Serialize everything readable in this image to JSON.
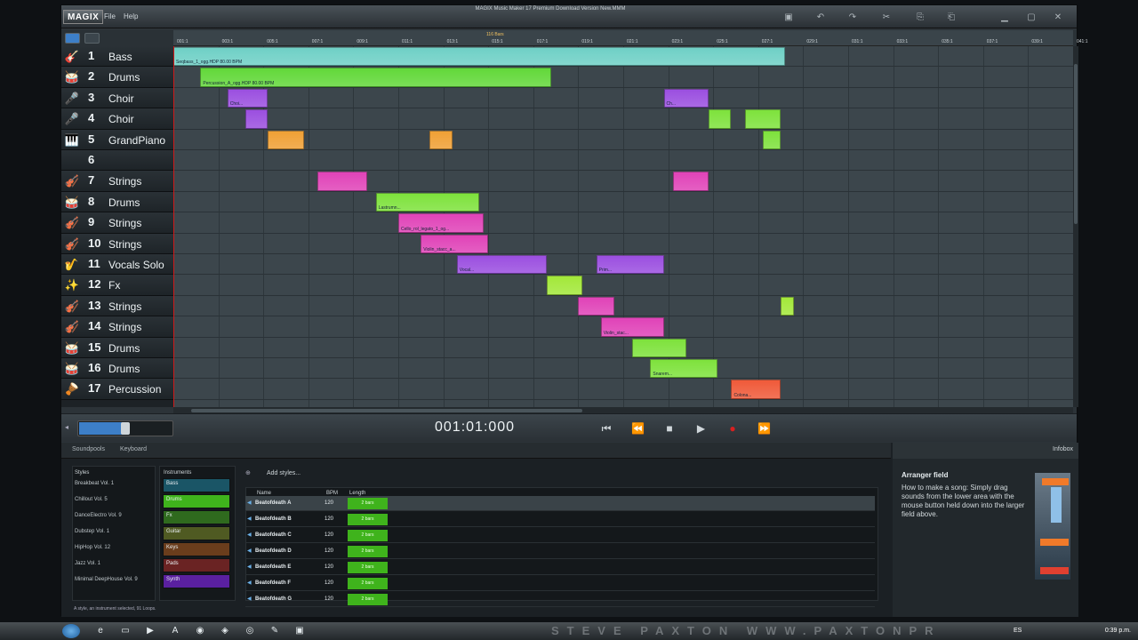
{
  "window": {
    "logo": "MAGIX",
    "menu": [
      "File",
      "Help"
    ],
    "title": "MAGIX Music Maker 17 Premium Download Version    New.MMM"
  },
  "ruler": {
    "label": "116 Bars",
    "ticks": [
      "001:1",
      "003:1",
      "005:1",
      "007:1",
      "009:1",
      "011:1",
      "013:1",
      "015:1",
      "017:1",
      "019:1",
      "021:1",
      "023:1",
      "025:1",
      "027:1",
      "029:1",
      "031:1",
      "033:1",
      "035:1",
      "037:1",
      "039:1",
      "041:1"
    ]
  },
  "tracks": [
    {
      "num": "1",
      "name": "Bass",
      "icon": "bass-guitar-icon",
      "glyph": "🎸"
    },
    {
      "num": "2",
      "name": "Drums",
      "icon": "drum-icon",
      "glyph": "🥁"
    },
    {
      "num": "3",
      "name": "Choir",
      "icon": "microphone-icon",
      "glyph": "🎤"
    },
    {
      "num": "4",
      "name": "Choir",
      "icon": "microphone-icon",
      "glyph": "🎤"
    },
    {
      "num": "5",
      "name": "GrandPiano",
      "icon": "piano-icon",
      "glyph": "🎹"
    },
    {
      "num": "6",
      "name": "",
      "icon": "empty-icon",
      "glyph": ""
    },
    {
      "num": "7",
      "name": "Strings",
      "icon": "violin-icon",
      "glyph": "🎻"
    },
    {
      "num": "8",
      "name": "Drums",
      "icon": "drum-icon",
      "glyph": "🥁"
    },
    {
      "num": "9",
      "name": "Strings",
      "icon": "violin-icon",
      "glyph": "🎻"
    },
    {
      "num": "10",
      "name": "Strings",
      "icon": "violin-icon",
      "glyph": "🎻"
    },
    {
      "num": "11",
      "name": "Vocals Solo",
      "icon": "saxophone-icon",
      "glyph": "🎷"
    },
    {
      "num": "12",
      "name": "Fx",
      "icon": "sound-fx-icon",
      "glyph": "✨"
    },
    {
      "num": "13",
      "name": "Strings",
      "icon": "violin-icon",
      "glyph": "🎻"
    },
    {
      "num": "14",
      "name": "Strings",
      "icon": "violin-icon",
      "glyph": "🎻"
    },
    {
      "num": "15",
      "name": "Drums",
      "icon": "drum-icon",
      "glyph": "🥁"
    },
    {
      "num": "16",
      "name": "Drums",
      "icon": "drum-icon",
      "glyph": "🥁"
    },
    {
      "num": "17",
      "name": "Percussion",
      "icon": "conga-icon",
      "glyph": "🪘"
    }
  ],
  "objects": [
    {
      "track": 1,
      "start": 0,
      "end": 13.6,
      "color": "#6fd0c6",
      "label": "Seqbass_1_ogg.HDP  80.00 BPM"
    },
    {
      "track": 2,
      "start": 0.6,
      "end": 8.4,
      "color": "#62d83a",
      "label": "Percussion_A_ogg.HDP  80.00 BPM"
    },
    {
      "track": 3,
      "start": 1.2,
      "end": 2.1,
      "color": "#9b4fe0",
      "label": "Choi..."
    },
    {
      "track": 3,
      "start": 10.9,
      "end": 11.9,
      "color": "#9b4fe0",
      "label": "Ch..."
    },
    {
      "track": 4,
      "start": 1.6,
      "end": 2.1,
      "color": "#9b4fe0",
      "label": ""
    },
    {
      "track": 4,
      "start": 11.9,
      "end": 12.4,
      "color": "#7ee23c",
      "label": ""
    },
    {
      "track": 4,
      "start": 12.7,
      "end": 13.5,
      "color": "#7ee23c",
      "label": ""
    },
    {
      "track": 5,
      "start": 2.1,
      "end": 2.9,
      "color": "#f0a035",
      "label": ""
    },
    {
      "track": 5,
      "start": 5.7,
      "end": 6.2,
      "color": "#f0a035",
      "label": ""
    },
    {
      "track": 5,
      "start": 13.1,
      "end": 13.5,
      "color": "#7ee23c",
      "label": ""
    },
    {
      "track": 7,
      "start": 3.2,
      "end": 4.3,
      "color": "#e043b8",
      "label": ""
    },
    {
      "track": 7,
      "start": 11.1,
      "end": 11.9,
      "color": "#e043b8",
      "label": ""
    },
    {
      "track": 8,
      "start": 4.5,
      "end": 6.8,
      "color": "#7ee23c",
      "label": "Lastrumn..."
    },
    {
      "track": 9,
      "start": 5.0,
      "end": 6.9,
      "color": "#e043b8",
      "label": "Cello_rol_legato_1_og..."
    },
    {
      "track": 10,
      "start": 5.5,
      "end": 7.0,
      "color": "#e043b8",
      "label": "Violin_stacc_a..."
    },
    {
      "track": 11,
      "start": 6.3,
      "end": 8.3,
      "color": "#9b4fe0",
      "label": "Vocal..."
    },
    {
      "track": 11,
      "start": 9.4,
      "end": 10.9,
      "color": "#9b4fe0",
      "label": "Prim..."
    },
    {
      "track": 12,
      "start": 8.3,
      "end": 9.1,
      "color": "#a3e83a",
      "label": ""
    },
    {
      "track": 13,
      "start": 9.0,
      "end": 9.8,
      "color": "#e043b8",
      "label": ""
    },
    {
      "track": 13,
      "start": 13.5,
      "end": 13.8,
      "color": "#a3e83a",
      "label": ""
    },
    {
      "track": 14,
      "start": 9.5,
      "end": 10.9,
      "color": "#e043b8",
      "label": "Violin_stac..."
    },
    {
      "track": 15,
      "start": 10.2,
      "end": 11.4,
      "color": "#7ee23c",
      "label": ""
    },
    {
      "track": 16,
      "start": 10.6,
      "end": 12.1,
      "color": "#7ee23c",
      "label": "Snarem..."
    },
    {
      "track": 17,
      "start": 12.4,
      "end": 13.5,
      "color": "#f05a3a",
      "label": "Colona..."
    }
  ],
  "transport": {
    "timecode": "001:01:000",
    "buttons": [
      {
        "name": "go-to-start-button",
        "glyph": "⏮"
      },
      {
        "name": "rewind-button",
        "glyph": "⏪"
      },
      {
        "name": "stop-button",
        "glyph": "■"
      },
      {
        "name": "play-button",
        "glyph": "▶"
      },
      {
        "name": "record-button",
        "glyph": "●"
      },
      {
        "name": "fast-forward-button",
        "glyph": "⏩"
      }
    ]
  },
  "panel": {
    "tabs": [
      "Soundpools",
      "Keyboard"
    ],
    "styles_header": "Styles",
    "instruments_header": "Instruments",
    "add_styles": "Add styles...",
    "styles": [
      "Breakbeat Vol. 1",
      "Chillout Vol. 5",
      "DanceElectro Vol. 9",
      "Dubstep Vol. 1",
      "HipHop Vol. 12",
      "Jazz Vol. 1",
      "Minimal DeepHouse Vol. 9"
    ],
    "instruments": [
      {
        "label": "Bass",
        "color": "#1a5566"
      },
      {
        "label": "Drums",
        "color": "#3fb31c"
      },
      {
        "label": "Fx",
        "color": "#2f6a1e"
      },
      {
        "label": "Guitar",
        "color": "#4f5a22"
      },
      {
        "label": "Keys",
        "color": "#6a3d1c"
      },
      {
        "label": "Pads",
        "color": "#6a2323"
      },
      {
        "label": "Synth",
        "color": "#5a20a0"
      }
    ],
    "list_headers": {
      "name": "Name",
      "bpm": "BPM",
      "length": "Length"
    },
    "loops": [
      {
        "name": "Beatofdeath A",
        "bpm": "120",
        "length": "2 bars"
      },
      {
        "name": "Beatofdeath B",
        "bpm": "120",
        "length": "2 bars"
      },
      {
        "name": "Beatofdeath C",
        "bpm": "120",
        "length": "2 bars"
      },
      {
        "name": "Beatofdeath D",
        "bpm": "120",
        "length": "2 bars"
      },
      {
        "name": "Beatofdeath E",
        "bpm": "120",
        "length": "2 bars"
      },
      {
        "name": "Beatofdeath F",
        "bpm": "120",
        "length": "2 bars"
      },
      {
        "name": "Beatofdeath G",
        "bpm": "120",
        "length": "2 bars"
      }
    ],
    "status": "A style, an instrument selected, 91 Loops."
  },
  "infobox": {
    "tab": "Infobox",
    "title": "Arranger field",
    "text": "How to make a song: Simply drag sounds from the lower area with the mouse button held down into the larger field above."
  },
  "taskbar": {
    "clock": "0:39 p.m.",
    "lang": "ES",
    "watermark": "STEVE PAXTON   WWW.PAXTONPR"
  }
}
